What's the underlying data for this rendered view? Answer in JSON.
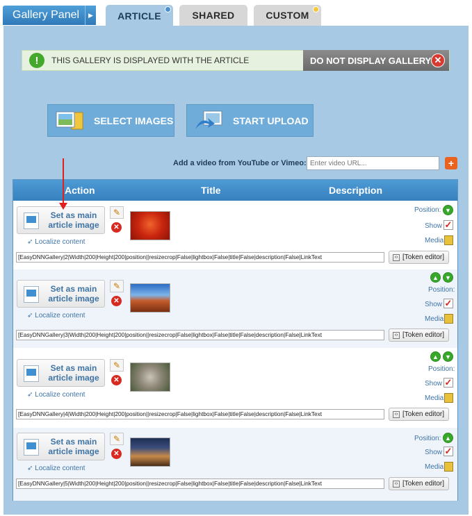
{
  "header": {
    "panel_title": "Gallery Panel",
    "tabs": [
      {
        "label": "ARTICLE",
        "active": true,
        "badge_color": "#4a8fd0"
      },
      {
        "label": "SHARED",
        "active": false
      },
      {
        "label": "CUSTOM",
        "active": false,
        "badge_color": "#f2c83b"
      }
    ]
  },
  "notice": {
    "text": "THIS GALLERY IS DISPLAYED WITH THE ARTICLE",
    "button_label": "DO NOT DISPLAY GALLERY"
  },
  "actions": {
    "select_images": "SELECT IMAGES",
    "start_upload": "START UPLOAD"
  },
  "video": {
    "label": "Add a video from YouTube or Vimeo:",
    "placeholder": "Enter video URL..."
  },
  "grid": {
    "columns": [
      "Action",
      "Title",
      "Description"
    ],
    "set_main_label": "Set as main article image",
    "localize_label": "Localize content",
    "position_label": "Position:",
    "show_label": "Show",
    "media_label": "Media",
    "token_button_label": "[Token editor]",
    "rows": [
      {
        "token": "[EasyDNNGallery|2|Width|200|Height|200|position||resizecrop|False|lightbox|False|title|False|description|False|LinkText",
        "thumb": "flower"
      },
      {
        "token": "[EasyDNNGallery|3|Width|200|Height|200|position||resizecrop|False|lightbox|False|title|False|description|False|LinkText",
        "thumb": "desert"
      },
      {
        "token": "[EasyDNNGallery|4|Width|200|Height|200|position||resizecrop|False|lightbox|False|title|False|description|False|LinkText",
        "thumb": "koala"
      },
      {
        "token": "[EasyDNNGallery|5|Width|200|Height|200|position||resizecrop|False|lightbox|False|title|False|description|False|LinkText",
        "thumb": "castle"
      }
    ]
  },
  "colors": {
    "panel_bg": "#a7c9e3",
    "header_blue": "#3680be",
    "accent_red": "#d72a20",
    "accent_green": "#38a82a"
  }
}
